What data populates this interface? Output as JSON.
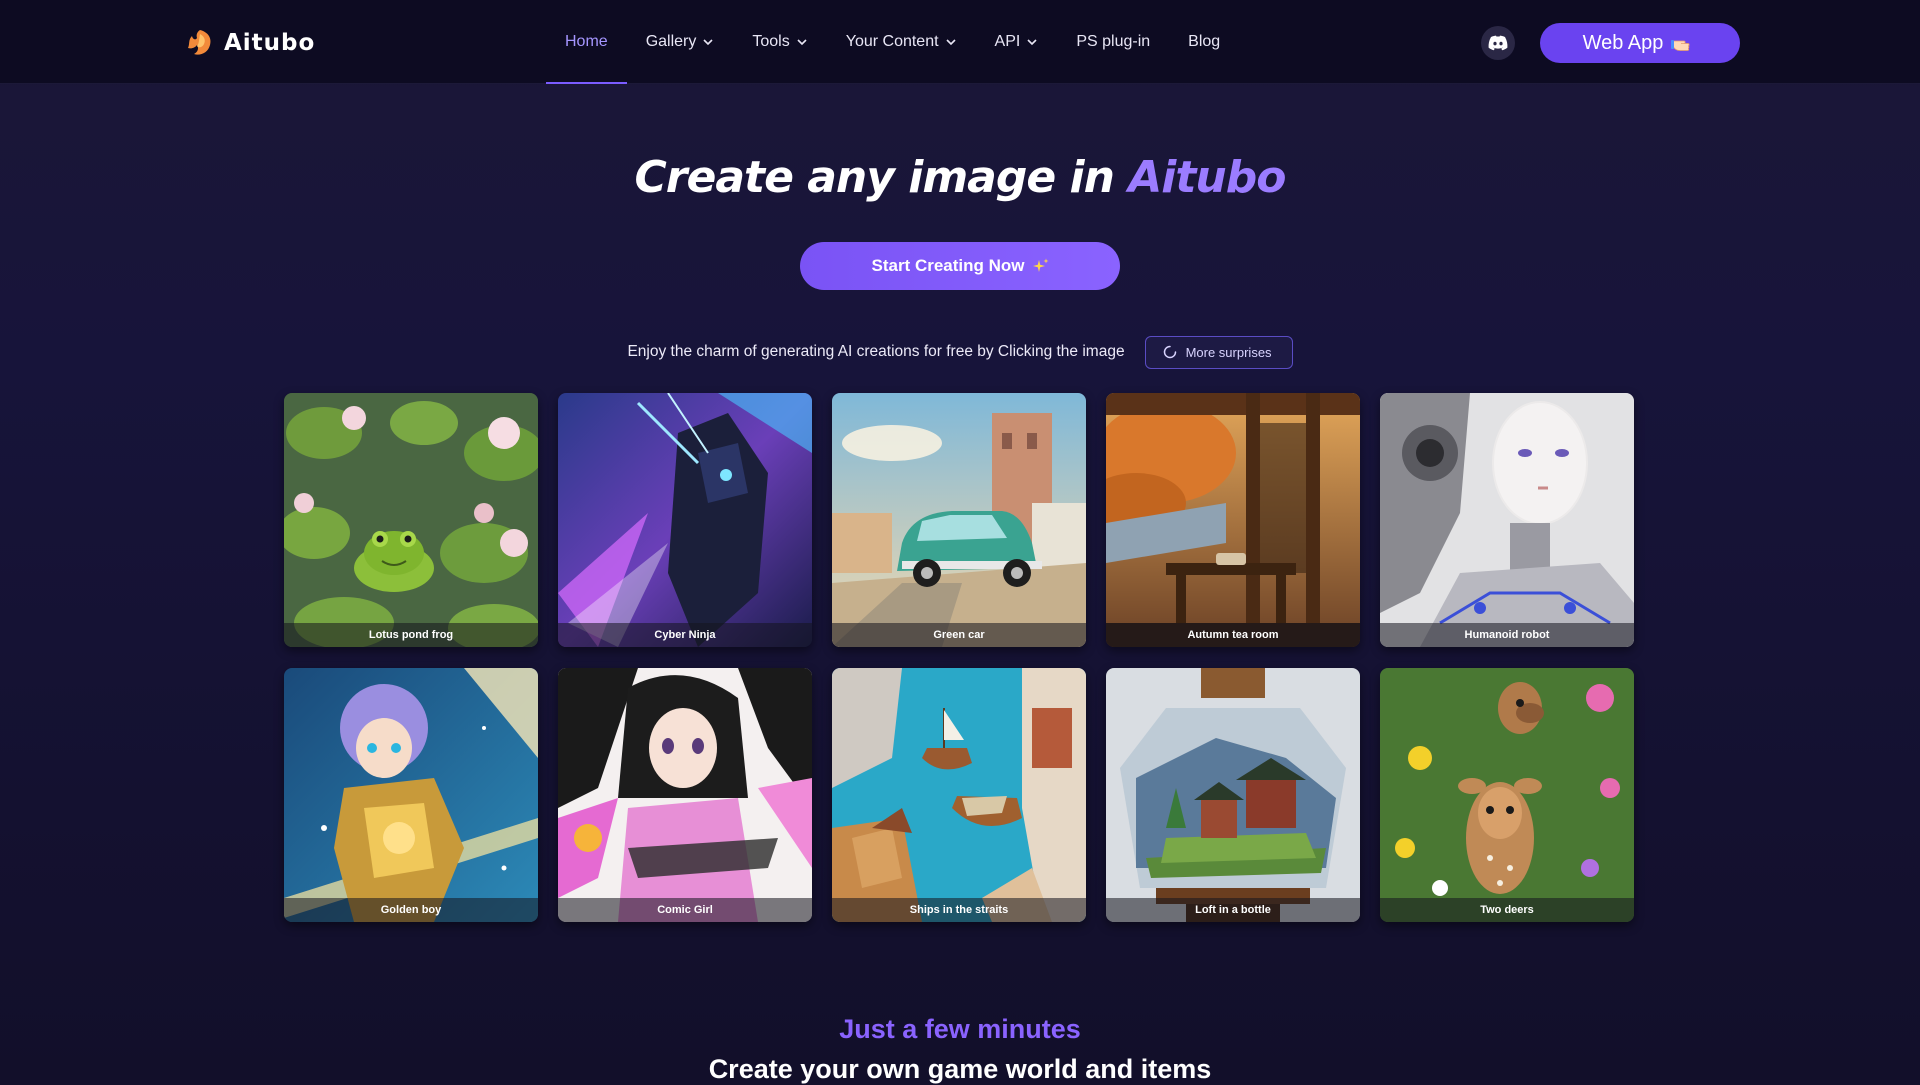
{
  "brand": {
    "name": "Aitubo",
    "logo_icon": "flame-logo-icon"
  },
  "nav": {
    "items": [
      {
        "label": "Home",
        "active": true,
        "dropdown": false
      },
      {
        "label": "Gallery",
        "active": false,
        "dropdown": true
      },
      {
        "label": "Tools",
        "active": false,
        "dropdown": true
      },
      {
        "label": "Your Content",
        "active": false,
        "dropdown": true
      },
      {
        "label": "API",
        "active": false,
        "dropdown": true
      },
      {
        "label": "PS plug-in",
        "active": false,
        "dropdown": false
      },
      {
        "label": "Blog",
        "active": false,
        "dropdown": false
      }
    ],
    "discord_icon": "discord-icon",
    "web_app_label": "Web App",
    "web_app_icon": "pointing-hand-icon"
  },
  "hero": {
    "title_prefix": "Create any image in ",
    "title_accent": "Aitubo",
    "cta_label": "Start Creating Now",
    "cta_icon": "sparkle-icon",
    "subtitle": "Enjoy the charm of generating AI creations for free by Clicking the image",
    "more_label": "More surprises",
    "more_icon": "refresh-icon"
  },
  "gallery": [
    {
      "label": "Lotus pond frog"
    },
    {
      "label": "Cyber Ninja"
    },
    {
      "label": "Green car"
    },
    {
      "label": "Autumn tea room"
    },
    {
      "label": "Humanoid robot"
    },
    {
      "label": "Golden boy"
    },
    {
      "label": "Comic Girl"
    },
    {
      "label": "Ships in the straits"
    },
    {
      "label": "Loft in a bottle"
    },
    {
      "label": "Two deers"
    }
  ],
  "section": {
    "kicker": "Just a few minutes",
    "title": "Create your own game world and items"
  },
  "colors": {
    "accent": "#7b5cff",
    "accent_light": "#9b7cff",
    "background": "#14112c",
    "navbar": "#0d0b22"
  }
}
